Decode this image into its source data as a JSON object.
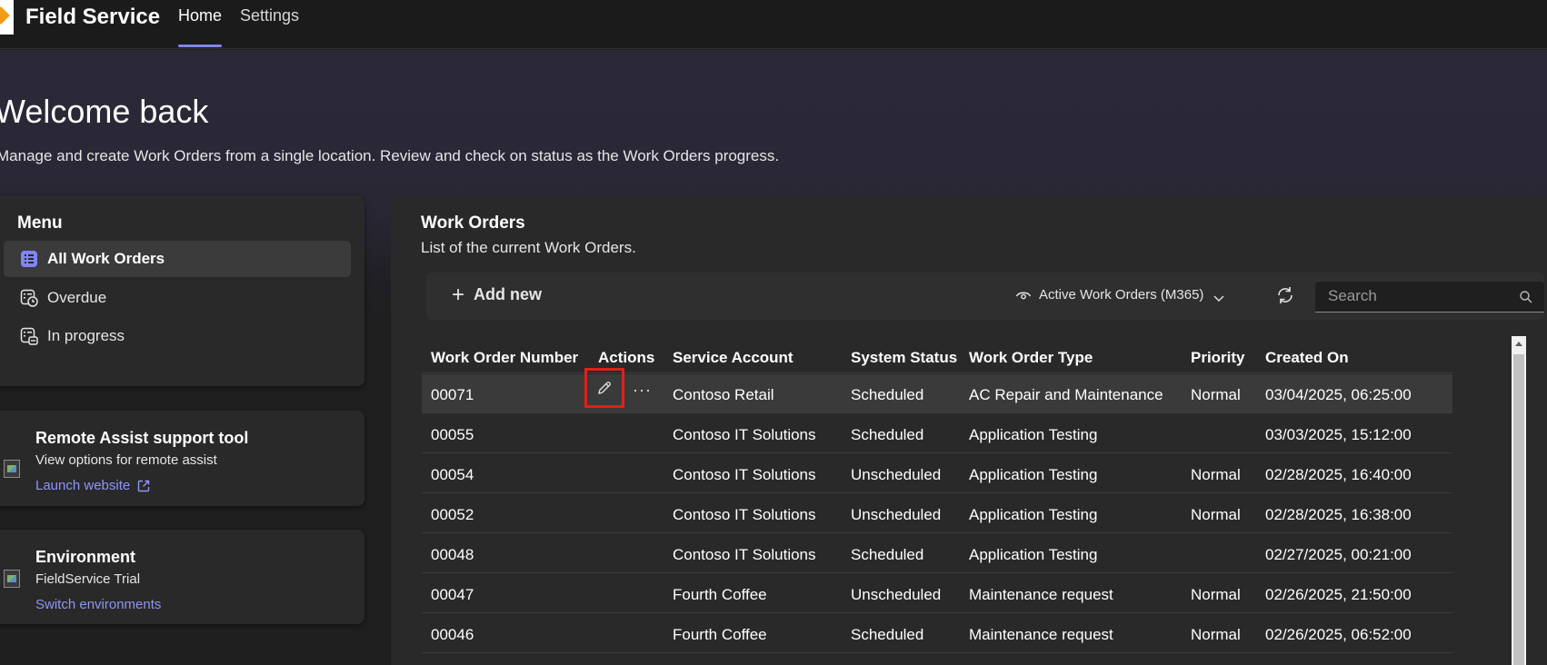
{
  "app": {
    "title": "Field Service"
  },
  "nav": {
    "tabs": [
      {
        "label": "Home",
        "active": true
      },
      {
        "label": "Settings",
        "active": false
      }
    ]
  },
  "hero": {
    "heading": "Welcome back",
    "subtitle": "Manage and create Work Orders from a single location. Review and check on status as the Work Orders progress."
  },
  "menu": {
    "title": "Menu",
    "items": [
      {
        "label": "All Work Orders",
        "icon": "list-icon",
        "active": true
      },
      {
        "label": "Overdue",
        "icon": "clock-list-icon",
        "active": false
      },
      {
        "label": "In progress",
        "icon": "progress-list-icon",
        "active": false
      }
    ]
  },
  "remote_assist": {
    "title": "Remote Assist support tool",
    "description": "View options for remote assist",
    "link": "Launch website"
  },
  "environment": {
    "title": "Environment",
    "name": "FieldService Trial",
    "link": "Switch environments"
  },
  "work_orders": {
    "title": "Work Orders",
    "subtitle": "List of the current Work Orders.",
    "toolbar": {
      "add_new": "Add new",
      "view": "Active Work Orders (M365)",
      "search_placeholder": "Search"
    },
    "columns": [
      "Work Order Number",
      "Actions",
      "Service Account",
      "System Status",
      "Work Order Type",
      "Priority",
      "Created On"
    ],
    "rows": [
      {
        "number": "00071",
        "account": "Contoso Retail",
        "status": "Scheduled",
        "type": "AC Repair and Maintenance",
        "priority": "Normal",
        "created": "03/04/2025, 06:25:00",
        "selected": true
      },
      {
        "number": "00055",
        "account": "Contoso IT Solutions",
        "status": "Scheduled",
        "type": "Application Testing",
        "priority": "",
        "created": "03/03/2025, 15:12:00"
      },
      {
        "number": "00054",
        "account": "Contoso IT Solutions",
        "status": "Unscheduled",
        "type": "Application Testing",
        "priority": "Normal",
        "created": "02/28/2025, 16:40:00"
      },
      {
        "number": "00052",
        "account": "Contoso IT Solutions",
        "status": "Unscheduled",
        "type": "Application Testing",
        "priority": "Normal",
        "created": "02/28/2025, 16:38:00"
      },
      {
        "number": "00048",
        "account": "Contoso IT Solutions",
        "status": "Scheduled",
        "type": "Application Testing",
        "priority": "",
        "created": "02/27/2025, 00:21:00"
      },
      {
        "number": "00047",
        "account": "Fourth Coffee",
        "status": "Unscheduled",
        "type": "Maintenance request",
        "priority": "Normal",
        "created": "02/26/2025, 21:50:00"
      },
      {
        "number": "00046",
        "account": "Fourth Coffee",
        "status": "Scheduled",
        "type": "Maintenance request",
        "priority": "Normal",
        "created": "02/26/2025, 06:52:00"
      }
    ],
    "more_label": "···"
  },
  "colors": {
    "accent": "#7f85f5",
    "link": "#8f95f7",
    "highlight_border": "#e0201a"
  }
}
